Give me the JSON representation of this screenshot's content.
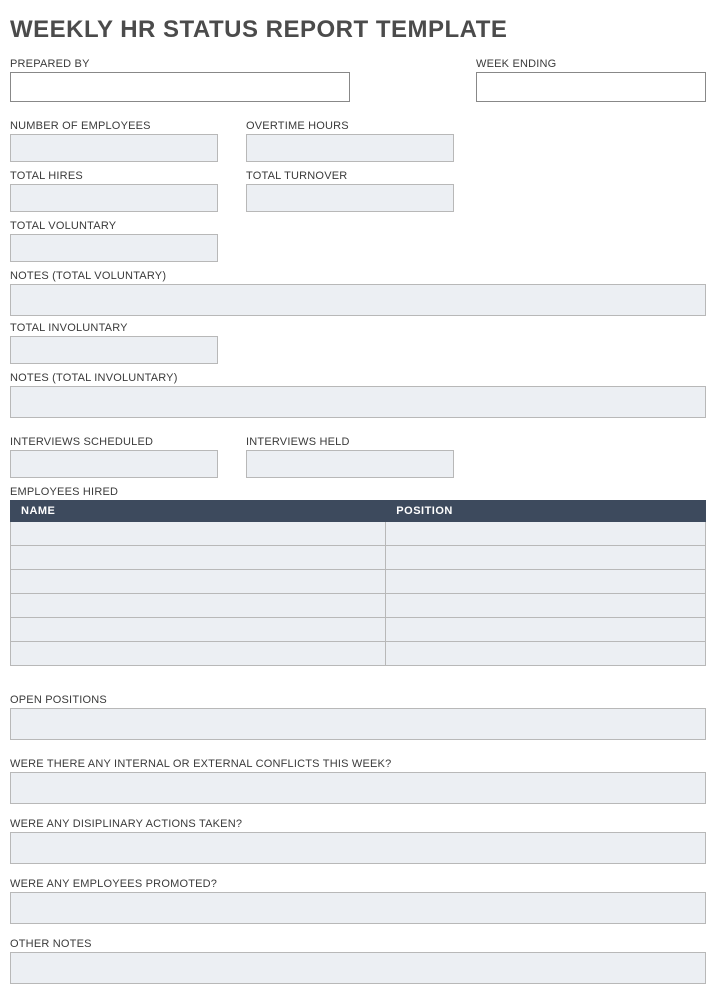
{
  "title": "WEEKLY HR STATUS REPORT TEMPLATE",
  "labels": {
    "prepared_by": "PREPARED BY",
    "week_ending": "WEEK ENDING",
    "number_of_employees": "NUMBER OF EMPLOYEES",
    "overtime_hours": "OVERTIME HOURS",
    "total_hires": "TOTAL HIRES",
    "total_turnover": "TOTAL TURNOVER",
    "total_voluntary": "TOTAL VOLUNTARY",
    "notes_total_voluntary": "NOTES (TOTAL VOLUNTARY)",
    "total_involuntary": "TOTAL INVOLUNTARY",
    "notes_total_involuntary": "NOTES (TOTAL INVOLUNTARY)",
    "interviews_scheduled": "INTERVIEWS SCHEDULED",
    "interviews_held": "INTERVIEWS HELD",
    "employees_hired": "EMPLOYEES HIRED",
    "open_positions": "OPEN POSITIONS",
    "conflicts": "WERE THERE ANY INTERNAL OR EXTERNAL CONFLICTS THIS WEEK?",
    "disciplinary": "WERE ANY DISIPLINARY ACTIONS TAKEN?",
    "promoted": "WERE ANY EMPLOYEES PROMOTED?",
    "other_notes": "OTHER NOTES"
  },
  "table": {
    "col_name": "NAME",
    "col_position": "POSITION",
    "rows": [
      {
        "name": "",
        "position": ""
      },
      {
        "name": "",
        "position": ""
      },
      {
        "name": "",
        "position": ""
      },
      {
        "name": "",
        "position": ""
      },
      {
        "name": "",
        "position": ""
      },
      {
        "name": "",
        "position": ""
      }
    ]
  },
  "values": {
    "prepared_by": "",
    "week_ending": "",
    "number_of_employees": "",
    "overtime_hours": "",
    "total_hires": "",
    "total_turnover": "",
    "total_voluntary": "",
    "notes_total_voluntary": "",
    "total_involuntary": "",
    "notes_total_involuntary": "",
    "interviews_scheduled": "",
    "interviews_held": "",
    "open_positions": "",
    "conflicts": "",
    "disciplinary": "",
    "promoted": "",
    "other_notes": ""
  }
}
